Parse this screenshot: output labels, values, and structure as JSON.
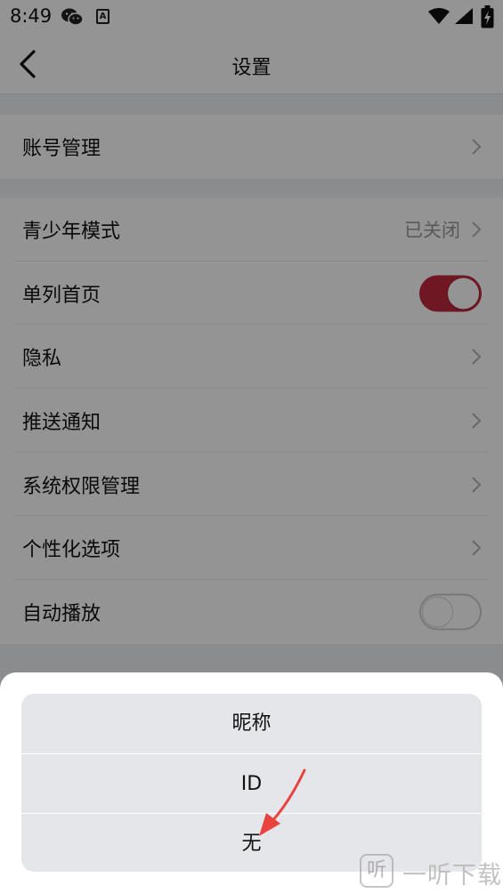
{
  "status_bar": {
    "time": "8:49",
    "icons": [
      "wechat-icon",
      "a-notification-icon",
      "wifi-icon",
      "signal-icon",
      "battery-charging-icon"
    ]
  },
  "header": {
    "title": "设置",
    "back_icon": "chevron-left-icon"
  },
  "settings": {
    "account": {
      "label": "账号管理"
    },
    "items": [
      {
        "label": "青少年模式",
        "value": "已关闭",
        "control": "chevron"
      },
      {
        "label": "单列首页",
        "control": "toggle",
        "on": true
      },
      {
        "label": "隐私",
        "control": "chevron"
      },
      {
        "label": "推送通知",
        "control": "chevron"
      },
      {
        "label": "系统权限管理",
        "control": "chevron"
      },
      {
        "label": "个性化选项",
        "control": "chevron"
      },
      {
        "label": "自动播放",
        "control": "toggle",
        "on": false
      }
    ]
  },
  "action_sheet": {
    "options": [
      "昵称",
      "ID",
      "无"
    ]
  },
  "watermark": {
    "logo_glyph": "听",
    "text": "一听下载"
  },
  "colors": {
    "accent": "#c2283f",
    "background": "#f0f1f3",
    "arrow": "#e8433f"
  }
}
